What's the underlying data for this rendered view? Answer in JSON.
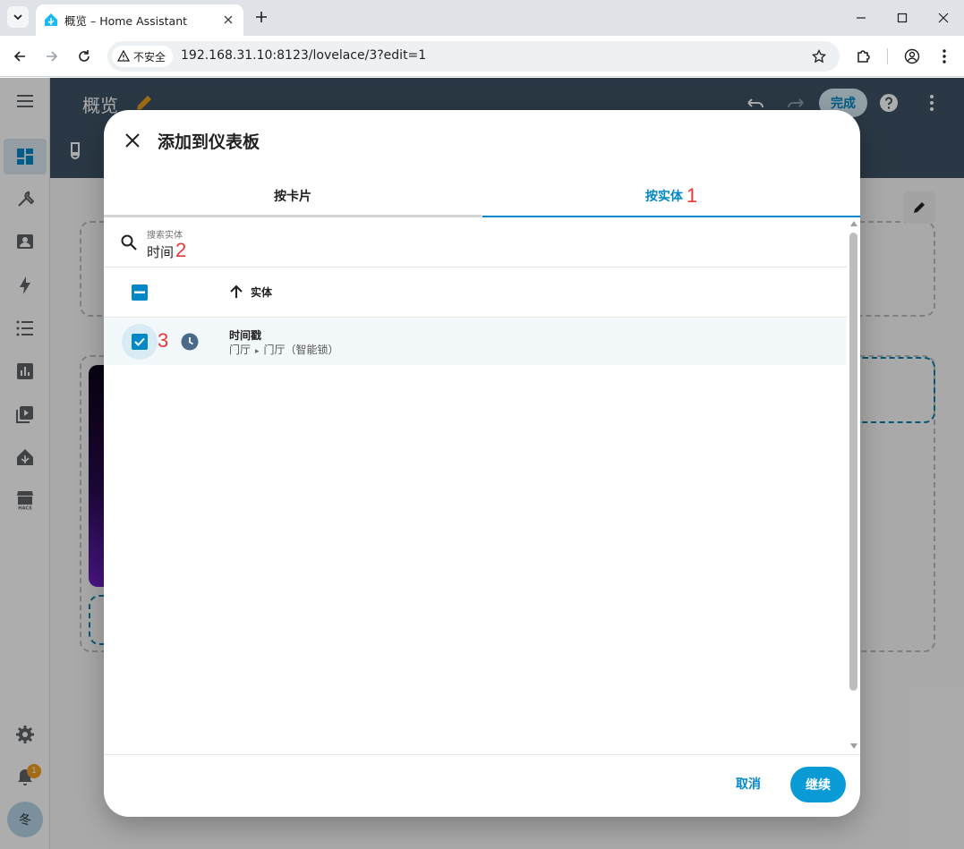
{
  "browser": {
    "tab_title": "概览 – Home Assistant",
    "security_label": "不安全",
    "url": "192.168.31.10:8123/lovelace/3?edit=1"
  },
  "app": {
    "header_title": "概览",
    "done_label": "完成",
    "notification_count": "1",
    "user_initial": "冬",
    "accent_color": "#0288c7",
    "header_color": "#3e5366"
  },
  "dialog": {
    "title": "添加到仪表板",
    "tabs": [
      {
        "label": "按卡片",
        "selected": false
      },
      {
        "label": "按实体",
        "selected": true
      }
    ],
    "annotations": {
      "tab": "1",
      "search": "2",
      "row": "3"
    },
    "search": {
      "label": "搜索实体",
      "value": "时间"
    },
    "table": {
      "column_header": "实体",
      "rows": [
        {
          "name": "时间戳",
          "area": "门厅",
          "device": "门厅（智能锁）",
          "icon": "clock-icon",
          "checked": true
        }
      ]
    },
    "footer": {
      "cancel": "取消",
      "continue": "继续"
    }
  }
}
